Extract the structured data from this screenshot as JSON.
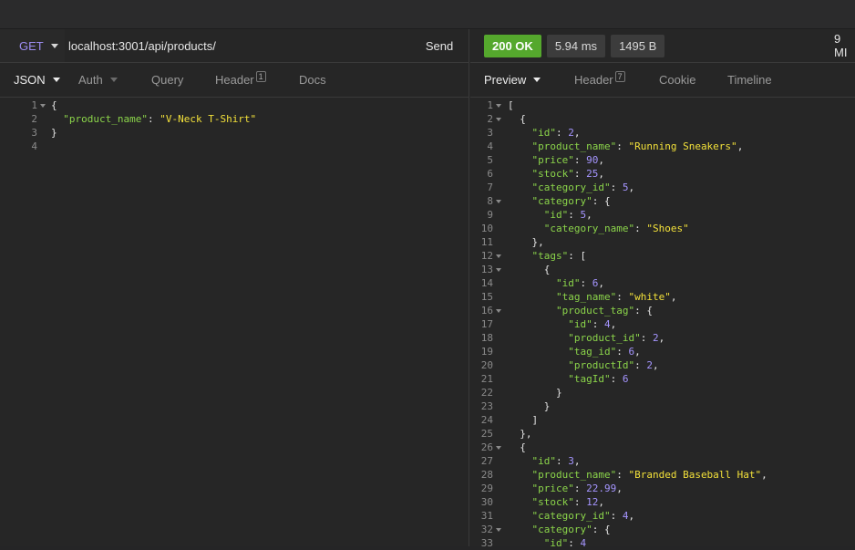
{
  "request": {
    "method": "GET",
    "url": "localhost:3001/api/products/",
    "send_label": "Send"
  },
  "request_tabs": [
    {
      "label": "JSON",
      "badge": ""
    },
    {
      "label": "Auth",
      "badge": ""
    },
    {
      "label": "Query",
      "badge": ""
    },
    {
      "label": "Header",
      "badge": "1"
    },
    {
      "label": "Docs",
      "badge": ""
    }
  ],
  "request_body": [
    {
      "n": "1",
      "fold": true,
      "parts": [
        [
          "p",
          "{"
        ]
      ]
    },
    {
      "n": "2",
      "fold": false,
      "parts": [
        [
          "p",
          "  "
        ],
        [
          "k",
          "\"product_name\""
        ],
        [
          "p",
          ": "
        ],
        [
          "s",
          "\"V-Neck T-Shirt\""
        ]
      ]
    },
    {
      "n": "3",
      "fold": false,
      "parts": [
        [
          "p",
          "}"
        ]
      ]
    },
    {
      "n": "4",
      "fold": false,
      "parts": []
    }
  ],
  "response": {
    "status": "200 OK",
    "time": "5.94 ms",
    "size": "1495 B",
    "extra": "9 MI"
  },
  "response_tabs": [
    {
      "label": "Preview",
      "badge": ""
    },
    {
      "label": "Header",
      "badge": "7"
    },
    {
      "label": "Cookie",
      "badge": ""
    },
    {
      "label": "Timeline",
      "badge": ""
    }
  ],
  "response_body": [
    {
      "n": "1",
      "fold": true,
      "parts": [
        [
          "p",
          "["
        ]
      ]
    },
    {
      "n": "2",
      "fold": true,
      "parts": [
        [
          "p",
          "  {"
        ]
      ]
    },
    {
      "n": "3",
      "fold": false,
      "parts": [
        [
          "p",
          "    "
        ],
        [
          "k",
          "\"id\""
        ],
        [
          "p",
          ": "
        ],
        [
          "n",
          "2"
        ],
        [
          "p",
          ","
        ]
      ]
    },
    {
      "n": "4",
      "fold": false,
      "parts": [
        [
          "p",
          "    "
        ],
        [
          "k",
          "\"product_name\""
        ],
        [
          "p",
          ": "
        ],
        [
          "s",
          "\"Running Sneakers\""
        ],
        [
          "p",
          ","
        ]
      ]
    },
    {
      "n": "5",
      "fold": false,
      "parts": [
        [
          "p",
          "    "
        ],
        [
          "k",
          "\"price\""
        ],
        [
          "p",
          ": "
        ],
        [
          "n",
          "90"
        ],
        [
          "p",
          ","
        ]
      ]
    },
    {
      "n": "6",
      "fold": false,
      "parts": [
        [
          "p",
          "    "
        ],
        [
          "k",
          "\"stock\""
        ],
        [
          "p",
          ": "
        ],
        [
          "n",
          "25"
        ],
        [
          "p",
          ","
        ]
      ]
    },
    {
      "n": "7",
      "fold": false,
      "parts": [
        [
          "p",
          "    "
        ],
        [
          "k",
          "\"category_id\""
        ],
        [
          "p",
          ": "
        ],
        [
          "n",
          "5"
        ],
        [
          "p",
          ","
        ]
      ]
    },
    {
      "n": "8",
      "fold": true,
      "parts": [
        [
          "p",
          "    "
        ],
        [
          "k",
          "\"category\""
        ],
        [
          "p",
          ": {"
        ]
      ]
    },
    {
      "n": "9",
      "fold": false,
      "parts": [
        [
          "p",
          "      "
        ],
        [
          "k",
          "\"id\""
        ],
        [
          "p",
          ": "
        ],
        [
          "n",
          "5"
        ],
        [
          "p",
          ","
        ]
      ]
    },
    {
      "n": "10",
      "fold": false,
      "parts": [
        [
          "p",
          "      "
        ],
        [
          "k",
          "\"category_name\""
        ],
        [
          "p",
          ": "
        ],
        [
          "s",
          "\"Shoes\""
        ]
      ]
    },
    {
      "n": "11",
      "fold": false,
      "parts": [
        [
          "p",
          "    },"
        ]
      ]
    },
    {
      "n": "12",
      "fold": true,
      "parts": [
        [
          "p",
          "    "
        ],
        [
          "k",
          "\"tags\""
        ],
        [
          "p",
          ": ["
        ]
      ]
    },
    {
      "n": "13",
      "fold": true,
      "parts": [
        [
          "p",
          "      {"
        ]
      ]
    },
    {
      "n": "14",
      "fold": false,
      "parts": [
        [
          "p",
          "        "
        ],
        [
          "k",
          "\"id\""
        ],
        [
          "p",
          ": "
        ],
        [
          "n",
          "6"
        ],
        [
          "p",
          ","
        ]
      ]
    },
    {
      "n": "15",
      "fold": false,
      "parts": [
        [
          "p",
          "        "
        ],
        [
          "k",
          "\"tag_name\""
        ],
        [
          "p",
          ": "
        ],
        [
          "s",
          "\"white\""
        ],
        [
          "p",
          ","
        ]
      ]
    },
    {
      "n": "16",
      "fold": true,
      "parts": [
        [
          "p",
          "        "
        ],
        [
          "k",
          "\"product_tag\""
        ],
        [
          "p",
          ": {"
        ]
      ]
    },
    {
      "n": "17",
      "fold": false,
      "parts": [
        [
          "p",
          "          "
        ],
        [
          "k",
          "\"id\""
        ],
        [
          "p",
          ": "
        ],
        [
          "n",
          "4"
        ],
        [
          "p",
          ","
        ]
      ]
    },
    {
      "n": "18",
      "fold": false,
      "parts": [
        [
          "p",
          "          "
        ],
        [
          "k",
          "\"product_id\""
        ],
        [
          "p",
          ": "
        ],
        [
          "n",
          "2"
        ],
        [
          "p",
          ","
        ]
      ]
    },
    {
      "n": "19",
      "fold": false,
      "parts": [
        [
          "p",
          "          "
        ],
        [
          "k",
          "\"tag_id\""
        ],
        [
          "p",
          ": "
        ],
        [
          "n",
          "6"
        ],
        [
          "p",
          ","
        ]
      ]
    },
    {
      "n": "20",
      "fold": false,
      "parts": [
        [
          "p",
          "          "
        ],
        [
          "k",
          "\"productId\""
        ],
        [
          "p",
          ": "
        ],
        [
          "n",
          "2"
        ],
        [
          "p",
          ","
        ]
      ]
    },
    {
      "n": "21",
      "fold": false,
      "parts": [
        [
          "p",
          "          "
        ],
        [
          "k",
          "\"tagId\""
        ],
        [
          "p",
          ": "
        ],
        [
          "n",
          "6"
        ]
      ]
    },
    {
      "n": "22",
      "fold": false,
      "parts": [
        [
          "p",
          "        }"
        ]
      ]
    },
    {
      "n": "23",
      "fold": false,
      "parts": [
        [
          "p",
          "      }"
        ]
      ]
    },
    {
      "n": "24",
      "fold": false,
      "parts": [
        [
          "p",
          "    ]"
        ]
      ]
    },
    {
      "n": "25",
      "fold": false,
      "parts": [
        [
          "p",
          "  },"
        ]
      ]
    },
    {
      "n": "26",
      "fold": true,
      "parts": [
        [
          "p",
          "  {"
        ]
      ]
    },
    {
      "n": "27",
      "fold": false,
      "parts": [
        [
          "p",
          "    "
        ],
        [
          "k",
          "\"id\""
        ],
        [
          "p",
          ": "
        ],
        [
          "n",
          "3"
        ],
        [
          "p",
          ","
        ]
      ]
    },
    {
      "n": "28",
      "fold": false,
      "parts": [
        [
          "p",
          "    "
        ],
        [
          "k",
          "\"product_name\""
        ],
        [
          "p",
          ": "
        ],
        [
          "s",
          "\"Branded Baseball Hat\""
        ],
        [
          "p",
          ","
        ]
      ]
    },
    {
      "n": "29",
      "fold": false,
      "parts": [
        [
          "p",
          "    "
        ],
        [
          "k",
          "\"price\""
        ],
        [
          "p",
          ": "
        ],
        [
          "n",
          "22.99"
        ],
        [
          "p",
          ","
        ]
      ]
    },
    {
      "n": "30",
      "fold": false,
      "parts": [
        [
          "p",
          "    "
        ],
        [
          "k",
          "\"stock\""
        ],
        [
          "p",
          ": "
        ],
        [
          "n",
          "12"
        ],
        [
          "p",
          ","
        ]
      ]
    },
    {
      "n": "31",
      "fold": false,
      "parts": [
        [
          "p",
          "    "
        ],
        [
          "k",
          "\"category_id\""
        ],
        [
          "p",
          ": "
        ],
        [
          "n",
          "4"
        ],
        [
          "p",
          ","
        ]
      ]
    },
    {
      "n": "32",
      "fold": true,
      "parts": [
        [
          "p",
          "    "
        ],
        [
          "k",
          "\"category\""
        ],
        [
          "p",
          ": {"
        ]
      ]
    },
    {
      "n": "33",
      "fold": false,
      "parts": [
        [
          "p",
          "      "
        ],
        [
          "k",
          "\"id\""
        ],
        [
          "p",
          ": "
        ],
        [
          "n",
          "4"
        ]
      ]
    }
  ]
}
